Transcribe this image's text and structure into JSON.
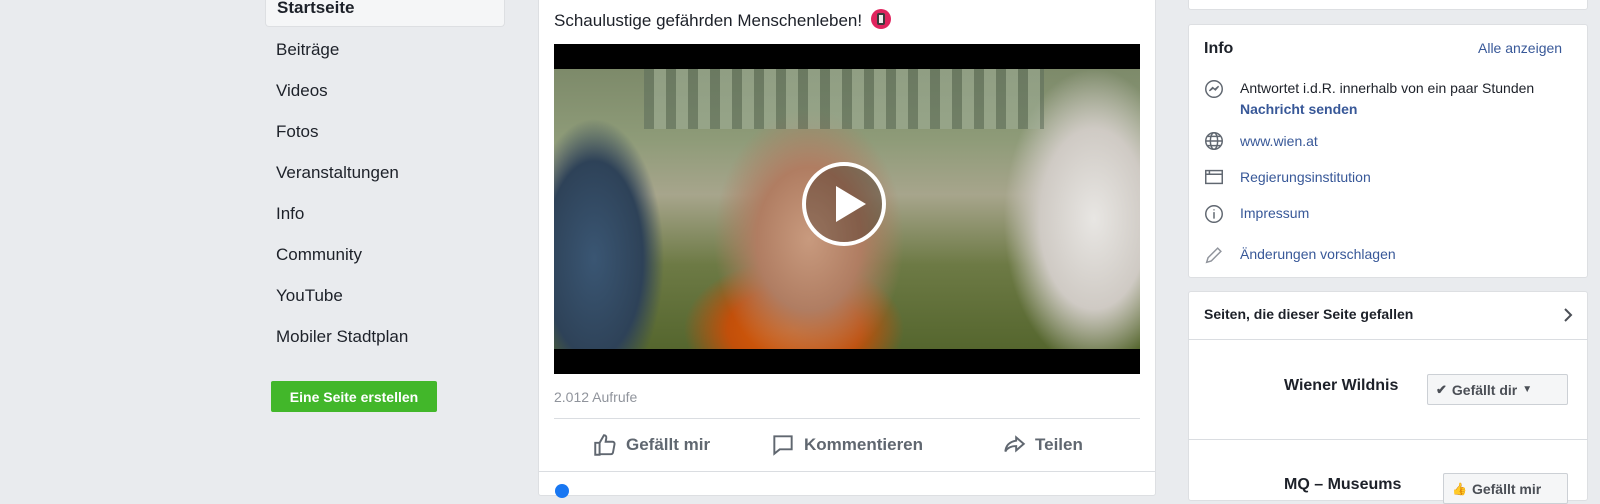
{
  "nav": {
    "active": "Startseite",
    "items": [
      "Beiträge",
      "Videos",
      "Fotos",
      "Veranstaltungen",
      "Info",
      "Community",
      "YouTube",
      "Mobiler Stadtplan"
    ],
    "create_button": "Eine Seite erstellen"
  },
  "post": {
    "text": "Schaulustige gefährden Menschenleben!",
    "views": "2.012 Aufrufe",
    "actions": {
      "like": "Gefällt mir",
      "comment": "Kommentieren",
      "share": "Teilen"
    }
  },
  "info": {
    "title": "Info",
    "see_all": "Alle anzeigen",
    "response": "Antwortet i.d.R. innerhalb von ein paar Stunden",
    "send_message": "Nachricht senden",
    "website": "www.wien.at",
    "category": "Regierungsinstitution",
    "imprint": "Impressum",
    "suggest_edits": "Änderungen vorschlagen"
  },
  "liked_pages": {
    "title": "Seiten, die dieser Seite gefallen",
    "pages": [
      {
        "name": "Wiener Wildnis",
        "button": "Gefällt dir"
      },
      {
        "name": "MQ – Museums",
        "button": "Gefällt mir"
      }
    ]
  },
  "colors": {
    "green": "#42b72a",
    "link": "#385898",
    "background": "#e9ebee"
  }
}
